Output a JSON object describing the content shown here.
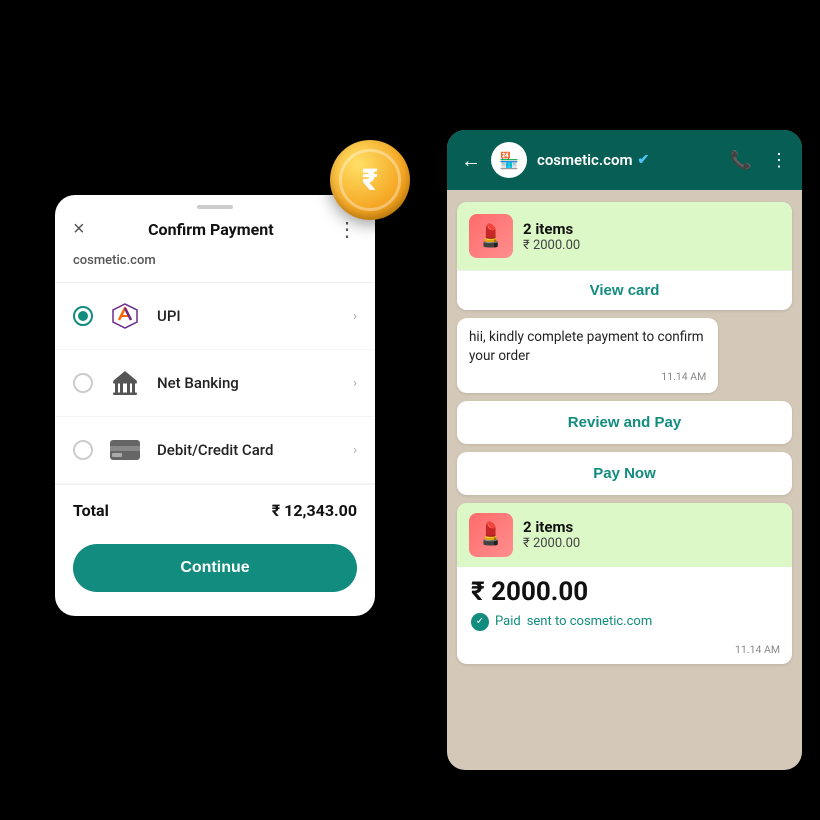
{
  "whatsapp": {
    "header": {
      "back_icon": "←",
      "avatar_emoji": "🏪",
      "name": "cosmetic.com",
      "verified_icon": "✔",
      "call_icon": "📞",
      "more_icon": "⋮"
    },
    "messages": [
      {
        "type": "product_card",
        "items_label": "2 items",
        "price": "₹ 2000.00",
        "view_btn": "View card"
      },
      {
        "type": "chat",
        "text": "hii, kindly complete payment to confirm your order",
        "time": "11.14 AM"
      },
      {
        "type": "action_btn",
        "label": "Review and Pay"
      },
      {
        "type": "action_btn",
        "label": "Pay Now"
      },
      {
        "type": "receipt",
        "items_label": "2 items",
        "price": "₹ 2000.00",
        "amount": "₹ 2000.00",
        "paid_label": "Paid",
        "paid_destination": "sent to cosmetic.com",
        "time": "11.14 AM"
      }
    ]
  },
  "payment_modal": {
    "drag_hint": "",
    "close_label": "×",
    "title": "Confirm Payment",
    "more_label": "⋮",
    "merchant": "cosmetic.com",
    "options": [
      {
        "id": "upi",
        "label": "UPI",
        "selected": true
      },
      {
        "id": "netbanking",
        "label": "Net Banking",
        "selected": false
      },
      {
        "id": "card",
        "label": "Debit/Credit Card",
        "selected": false
      }
    ],
    "total_label": "Total",
    "total_amount": "₹ 12,343.00",
    "continue_btn": "Continue"
  },
  "coin": {
    "symbol": "₹"
  }
}
